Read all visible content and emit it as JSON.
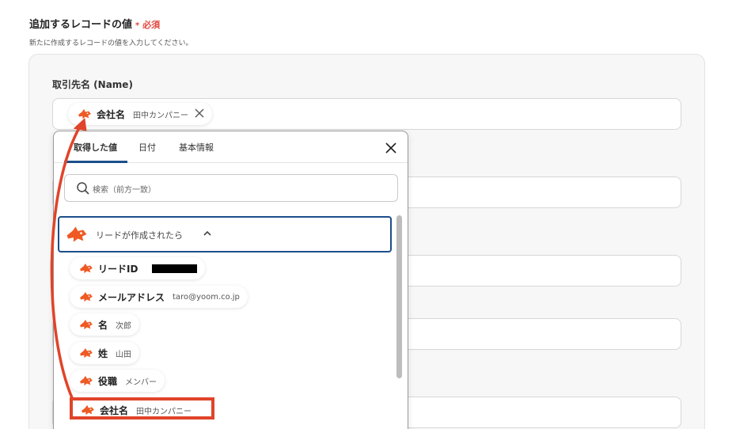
{
  "section": {
    "title": "追加するレコードの値",
    "required_star": "*",
    "required_label": "必須",
    "description": "新たに作成するレコードの値を入力してください。"
  },
  "field": {
    "label": "取引先名 (Name)",
    "selected_chip": {
      "name": "会社名",
      "value": "田中カンパニー"
    }
  },
  "popup": {
    "tabs": [
      {
        "label": "取得した値",
        "active": true
      },
      {
        "label": "日付",
        "active": false
      },
      {
        "label": "基本情報",
        "active": false
      }
    ],
    "search_placeholder": "検索（前方一致）",
    "group_label": "リードが作成されたら",
    "items": [
      {
        "name": "リードID",
        "value": "",
        "redacted": true
      },
      {
        "name": "メールアドレス",
        "value": "taro@yoom.co.jp"
      },
      {
        "name": "名",
        "value": "次郎"
      },
      {
        "name": "姓",
        "value": "山田"
      },
      {
        "name": "役職",
        "value": "メンバー"
      },
      {
        "name": "会社名",
        "value": "田中カンパニー",
        "highlighted": true
      }
    ]
  },
  "colors": {
    "brand_orange": "#ef5a24",
    "highlight_red": "#e0442a",
    "active_tab": "#1b4f8a",
    "required_red": "#e0483e"
  },
  "icons": [
    "yoom-logo-icon",
    "close-icon",
    "search-icon",
    "chevron-up-icon",
    "arrow-annotation"
  ]
}
